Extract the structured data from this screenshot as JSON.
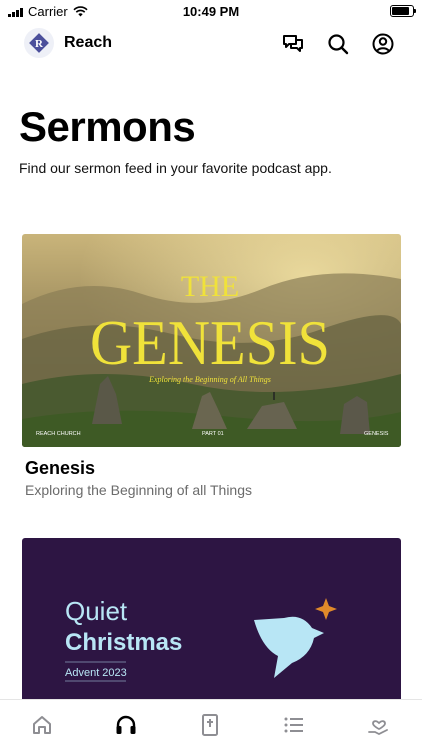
{
  "status_bar": {
    "carrier": "Carrier",
    "time": "10:49 PM"
  },
  "header": {
    "app_name": "Reach",
    "logo_letter": "R",
    "icons": [
      "chat-icon",
      "search-icon",
      "profile-icon"
    ]
  },
  "page": {
    "title": "Sermons",
    "subtitle": "Find our sermon feed in your favorite podcast app."
  },
  "series": [
    {
      "title": "Genesis",
      "subtitle": "Exploring the Beginning of all Things",
      "art": {
        "top_word": "THE",
        "main_word": "GENESIS",
        "tagline": "Exploring the Beginning of All Things",
        "footer_left": "REACH CHURCH",
        "footer_center": "PART 01",
        "footer_right": "GENESIS"
      }
    },
    {
      "art": {
        "line1": "Quiet",
        "line2": "Christmas",
        "line3": "Advent 2023"
      }
    }
  ],
  "tab_bar": {
    "tabs": [
      "home-icon",
      "headphones-icon",
      "bible-icon",
      "list-icon",
      "giving-icon"
    ],
    "active": "headphones-icon"
  },
  "colors": {
    "genesis_text": "#f0e23a",
    "christmas_bg": "#2d1543",
    "christmas_text": "#b8e6f5",
    "dove": "#b8e6f5",
    "star": "#e08a2a"
  }
}
